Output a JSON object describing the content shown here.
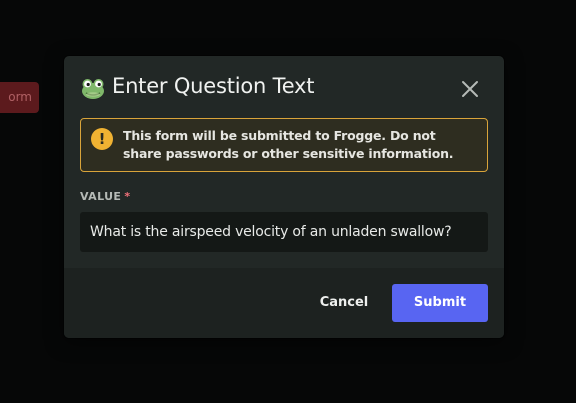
{
  "background": {
    "partial_button_label": "orm"
  },
  "modal": {
    "title": "Enter Question Text",
    "warning_text": "This form will be submitted to Frogge. Do not share passwords or other sensitive information.",
    "warning_icon_glyph": "!",
    "field": {
      "label": "VALUE",
      "required_marker": "*",
      "value": "What is the airspeed velocity of an unladen swallow?"
    },
    "cancel_label": "Cancel",
    "submit_label": "Submit"
  },
  "colors": {
    "accent": "#5865f2",
    "warning_border": "#d9a43a",
    "warning_icon": "#f0b232",
    "required": "#f2717a"
  },
  "icons": {
    "app": "frog-icon",
    "close": "close-icon",
    "warning": "warning-icon"
  }
}
